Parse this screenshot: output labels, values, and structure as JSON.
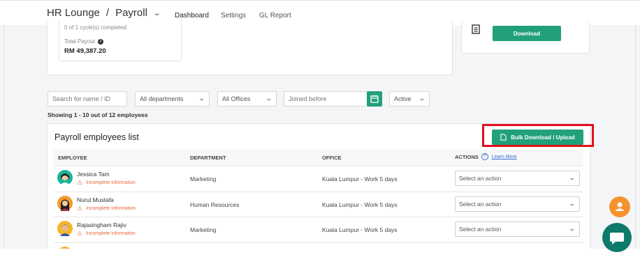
{
  "header": {
    "app_name": "HR Lounge",
    "separator": "/",
    "section": "Payroll",
    "tabs": [
      {
        "label": "Dashboard",
        "active": true
      },
      {
        "label": "Settings",
        "active": false
      },
      {
        "label": "GL Report",
        "active": false
      }
    ]
  },
  "summary_card": {
    "cycles_text": "0 of 1 cycle(s) completed",
    "total_payout_label": "Total Payout",
    "total_payout_value": "RM 49,387.20"
  },
  "download_card": {
    "button_label": "Download"
  },
  "filters": {
    "search_placeholder": "Search for name / ID",
    "department": "All departments",
    "office": "All Offices",
    "joined_placeholder": "Joined before",
    "status": "Active"
  },
  "showing_text": "Showing 1 - 10 out of 12 employees",
  "list": {
    "title": "Payroll employees list",
    "bulk_button_label": "Bulk Download / Upload",
    "columns": {
      "employee": "EMPLOYEE",
      "department": "DEPARTMENT",
      "office": "OFFICE",
      "actions": "ACTIONS",
      "learn_more": "Learn More"
    },
    "rows": [
      {
        "name": "Jessica Tam",
        "warning": "Incomplete information",
        "department": "Marketing",
        "office": "Kuala Lumpur - Work 5 days",
        "action_placeholder": "Select an action"
      },
      {
        "name": "Nurul Mustafa",
        "warning": "Incomplete information",
        "department": "Human Resources",
        "office": "Kuala Lumpur - Work 5 days",
        "action_placeholder": "Select an action"
      },
      {
        "name": "Rajasingham Rajiv",
        "warning": "Incomplete information",
        "department": "Marketing",
        "office": "Kuala Lumpur - Work 5 days",
        "action_placeholder": "Select an action"
      }
    ]
  },
  "colors": {
    "accent": "#21a07a",
    "warning": "#e8663a",
    "highlight": "#e0101a",
    "fab_orange": "#f5922e",
    "fab_teal": "#0e7a6a"
  },
  "icons": [
    "chevron-down-icon",
    "info-icon",
    "document-icon",
    "calendar-icon",
    "file-icon",
    "help-icon",
    "warning-icon",
    "user-icon",
    "chat-icon"
  ]
}
